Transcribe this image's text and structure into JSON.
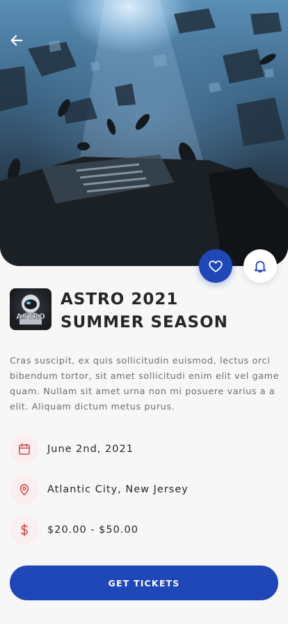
{
  "event": {
    "title_line1": "ASTRO 2021",
    "title_line2": "SUMMER SEASON",
    "description": "Cras suscipit, ex quis sollicitudin euismod, lectus orci bibendum tortor, sit amet sollicitudi enim elit vel game quam. Nullam sit amet urna non mi posuere varius a a elit. Aliquam dictum metus purus.",
    "logo_text": "ASTRO"
  },
  "details": {
    "date": "June 2nd, 2021",
    "location": "Atlantic City, New Jersey",
    "price": "$20.00 - $50.00"
  },
  "actions": {
    "cta_label": "GET TICKETS"
  },
  "icons": {
    "back": "arrow-left-icon",
    "favorite": "heart-icon",
    "notify": "bell-icon",
    "date": "calendar-icon",
    "location": "map-pin-icon",
    "price": "dollar-icon"
  },
  "colors": {
    "primary": "#1f47b8",
    "accent": "#d64545",
    "accent_bg": "#fbeeee",
    "background": "#f7f7f8"
  }
}
